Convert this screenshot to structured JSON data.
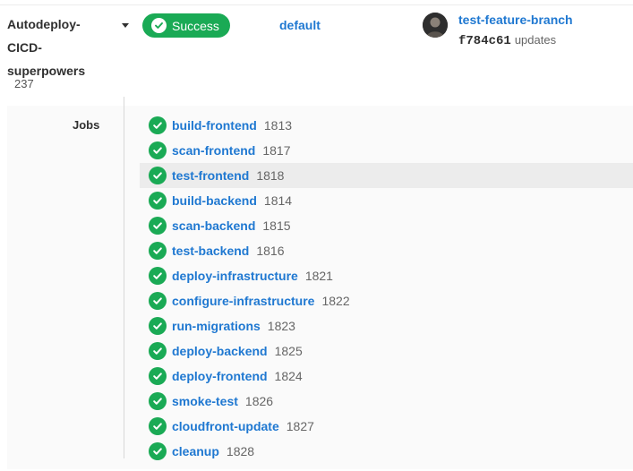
{
  "pipeline": {
    "project_name": "Autodeploy-\nCICD-\nsuperpowers",
    "project_id": "237",
    "status_label": "Success",
    "environment": "default",
    "branch": "test-feature-branch",
    "commit_sha": "f784c61",
    "commit_message": "updates"
  },
  "jobs_label": "Jobs",
  "jobs": [
    {
      "name": "build-frontend",
      "id": "1813",
      "status": "success"
    },
    {
      "name": "scan-frontend",
      "id": "1817",
      "status": "success"
    },
    {
      "name": "test-frontend",
      "id": "1818",
      "status": "success"
    },
    {
      "name": "build-backend",
      "id": "1814",
      "status": "success"
    },
    {
      "name": "scan-backend",
      "id": "1815",
      "status": "success"
    },
    {
      "name": "test-backend",
      "id": "1816",
      "status": "success"
    },
    {
      "name": "deploy-infrastructure",
      "id": "1821",
      "status": "success"
    },
    {
      "name": "configure-infrastructure",
      "id": "1822",
      "status": "success"
    },
    {
      "name": "run-migrations",
      "id": "1823",
      "status": "success"
    },
    {
      "name": "deploy-backend",
      "id": "1825",
      "status": "success"
    },
    {
      "name": "deploy-frontend",
      "id": "1824",
      "status": "success"
    },
    {
      "name": "smoke-test",
      "id": "1826",
      "status": "success"
    },
    {
      "name": "cloudfront-update",
      "id": "1827",
      "status": "success"
    },
    {
      "name": "cleanup",
      "id": "1828",
      "status": "success"
    }
  ],
  "icons": {
    "status": "check-circle-icon",
    "toggle": "chevron-down-icon",
    "avatar": "user-avatar"
  },
  "colors": {
    "success": "#1aaa55",
    "link": "#1f78d1",
    "row_highlight": "#ececec",
    "panel_bg": "#fafafa"
  }
}
